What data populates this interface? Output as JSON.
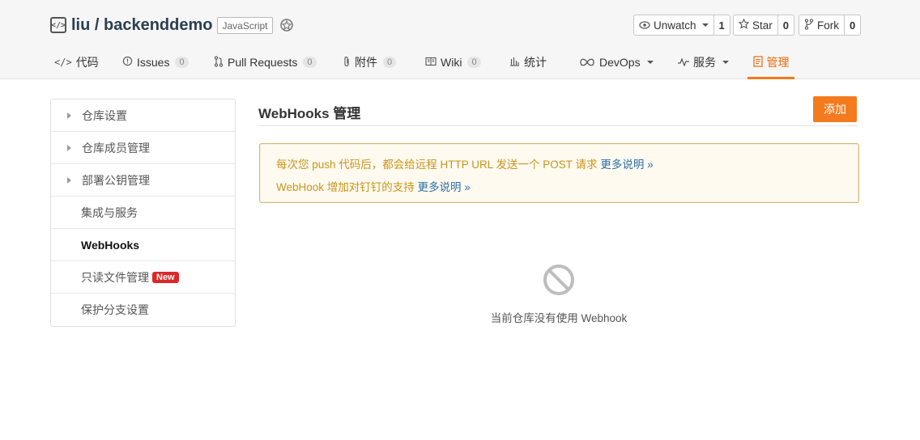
{
  "repo": {
    "path": "liu / backenddemo",
    "language": "JavaScript",
    "icon": "code-bracket-icon",
    "badge_icon": "award-icon"
  },
  "actions": {
    "watch": {
      "label": "Unwatch",
      "count": "1",
      "icon": "eye-icon"
    },
    "star": {
      "label": "Star",
      "count": "0",
      "icon": "star-icon"
    },
    "fork": {
      "label": "Fork",
      "count": "0",
      "icon": "fork-icon"
    }
  },
  "nav": [
    {
      "label": "代码",
      "icon": "code-icon"
    },
    {
      "label": "Issues",
      "count": "0",
      "icon": "issue-icon"
    },
    {
      "label": "Pull Requests",
      "count": "0",
      "icon": "pull-request-icon"
    },
    {
      "label": "附件",
      "count": "0",
      "icon": "paperclip-icon"
    },
    {
      "label": "Wiki",
      "count": "0",
      "icon": "book-icon"
    },
    {
      "label": "统计",
      "icon": "bar-chart-icon"
    },
    {
      "label": "DevOps",
      "icon": "infinity-icon"
    },
    {
      "label": "服务",
      "icon": "pulse-icon"
    },
    {
      "label": "管理",
      "icon": "settings-doc-icon"
    }
  ],
  "sidebar": [
    {
      "label": "仓库设置"
    },
    {
      "label": "仓库成员管理"
    },
    {
      "label": "部署公钥管理"
    },
    {
      "label": "集成与服务"
    },
    {
      "label": "WebHooks"
    },
    {
      "label": "只读文件管理",
      "badge": "New"
    },
    {
      "label": "保护分支设置"
    }
  ],
  "main": {
    "title": "WebHooks 管理",
    "add_label": "添加",
    "notice": {
      "line1": "每次您 push 代码后，都会给远程 HTTP URL 发送一个 POST 请求",
      "line1_link": "更多说明 »",
      "line2": "WebHook 增加对钉钉的支持",
      "line2_link": "更多说明 »"
    },
    "empty_text": "当前仓库没有使用 Webhook",
    "empty_icon": "prohibited-icon"
  },
  "colors": {
    "accent": "#f37b1d",
    "active_tab": "#e8690c",
    "notice_text": "#c7951a",
    "link": "#2a6ea6",
    "new_badge": "#db2828"
  }
}
